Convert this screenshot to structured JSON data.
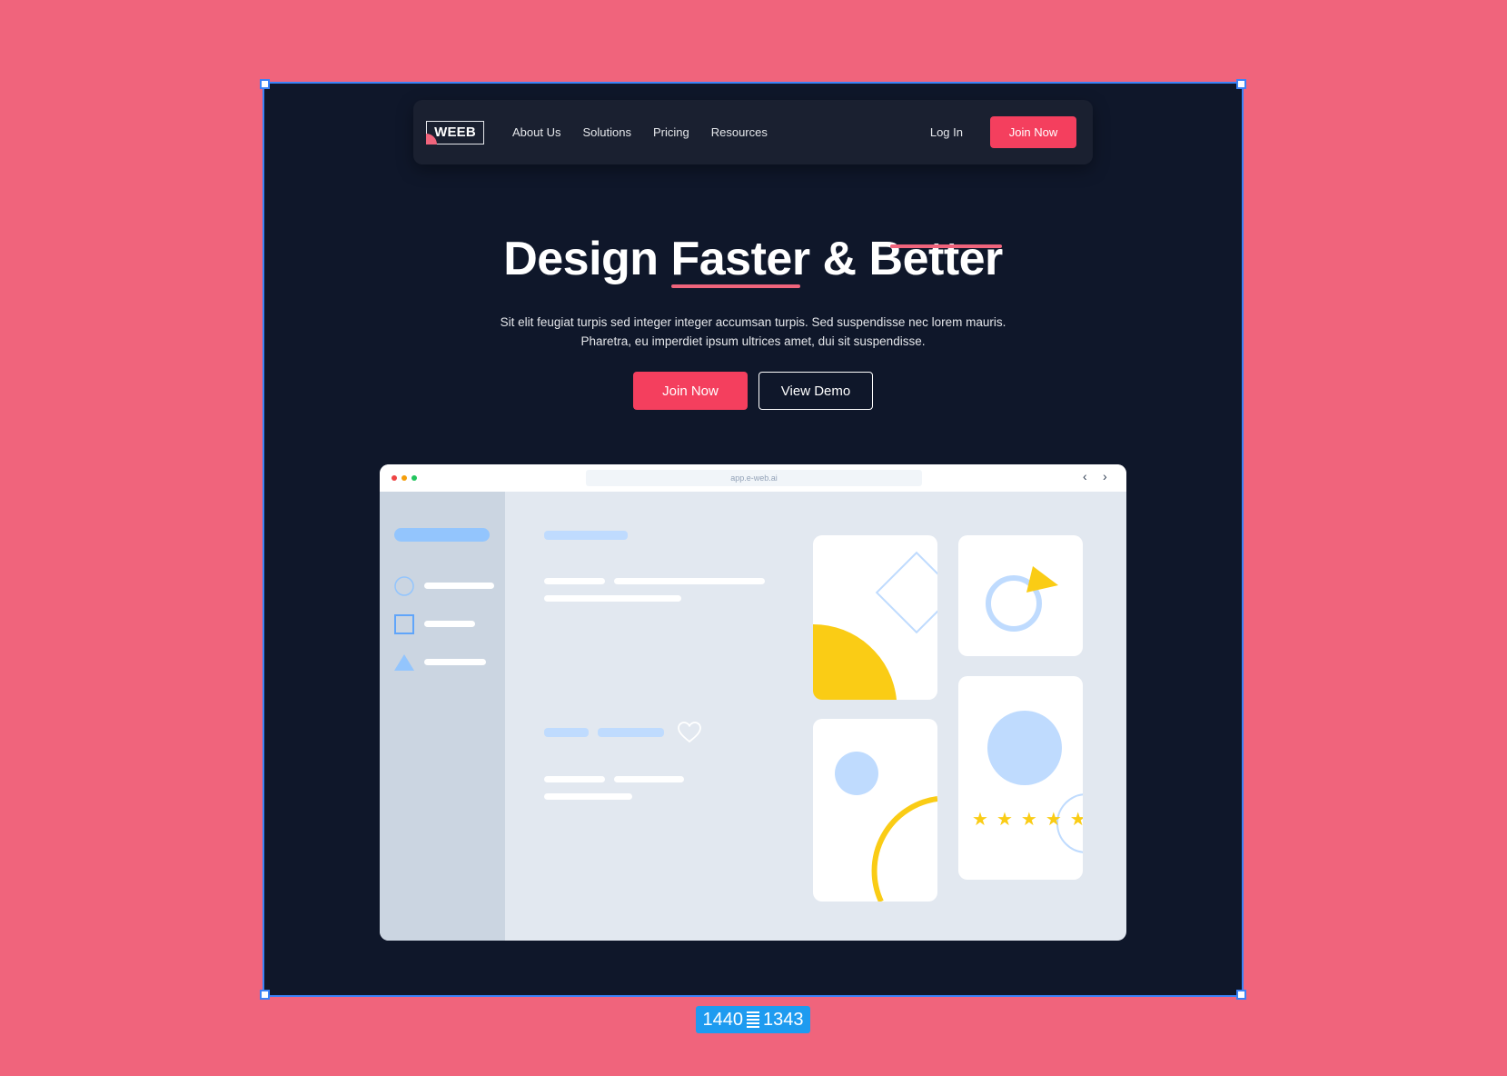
{
  "canvas": {
    "artboard_size": {
      "width": "1440",
      "height": "1343"
    }
  },
  "navbar": {
    "logo": "WEEB",
    "links": [
      "About Us",
      "Solutions",
      "Pricing",
      "Resources"
    ],
    "login_label": "Log In",
    "join_label": "Join Now"
  },
  "hero": {
    "title": "Design Faster & Better",
    "subtitle_line1": "Sit elit feugiat turpis sed integer integer accumsan turpis. Sed suspendisse nec lorem mauris.",
    "subtitle_line2": "Pharetra, eu imperdiet ipsum ultrices amet, dui sit suspendisse.",
    "primary_cta": "Join Now",
    "secondary_cta": "View Demo"
  },
  "mockup": {
    "url": "app.e-web.ai",
    "rating_stars": 5
  },
  "colors": {
    "background": "#f0647c",
    "frame": "#0f172a",
    "accent": "#f43f5e",
    "selection": "#3b82f6",
    "mock_blue": "#bfdbfe",
    "mock_yellow": "#facc15"
  }
}
